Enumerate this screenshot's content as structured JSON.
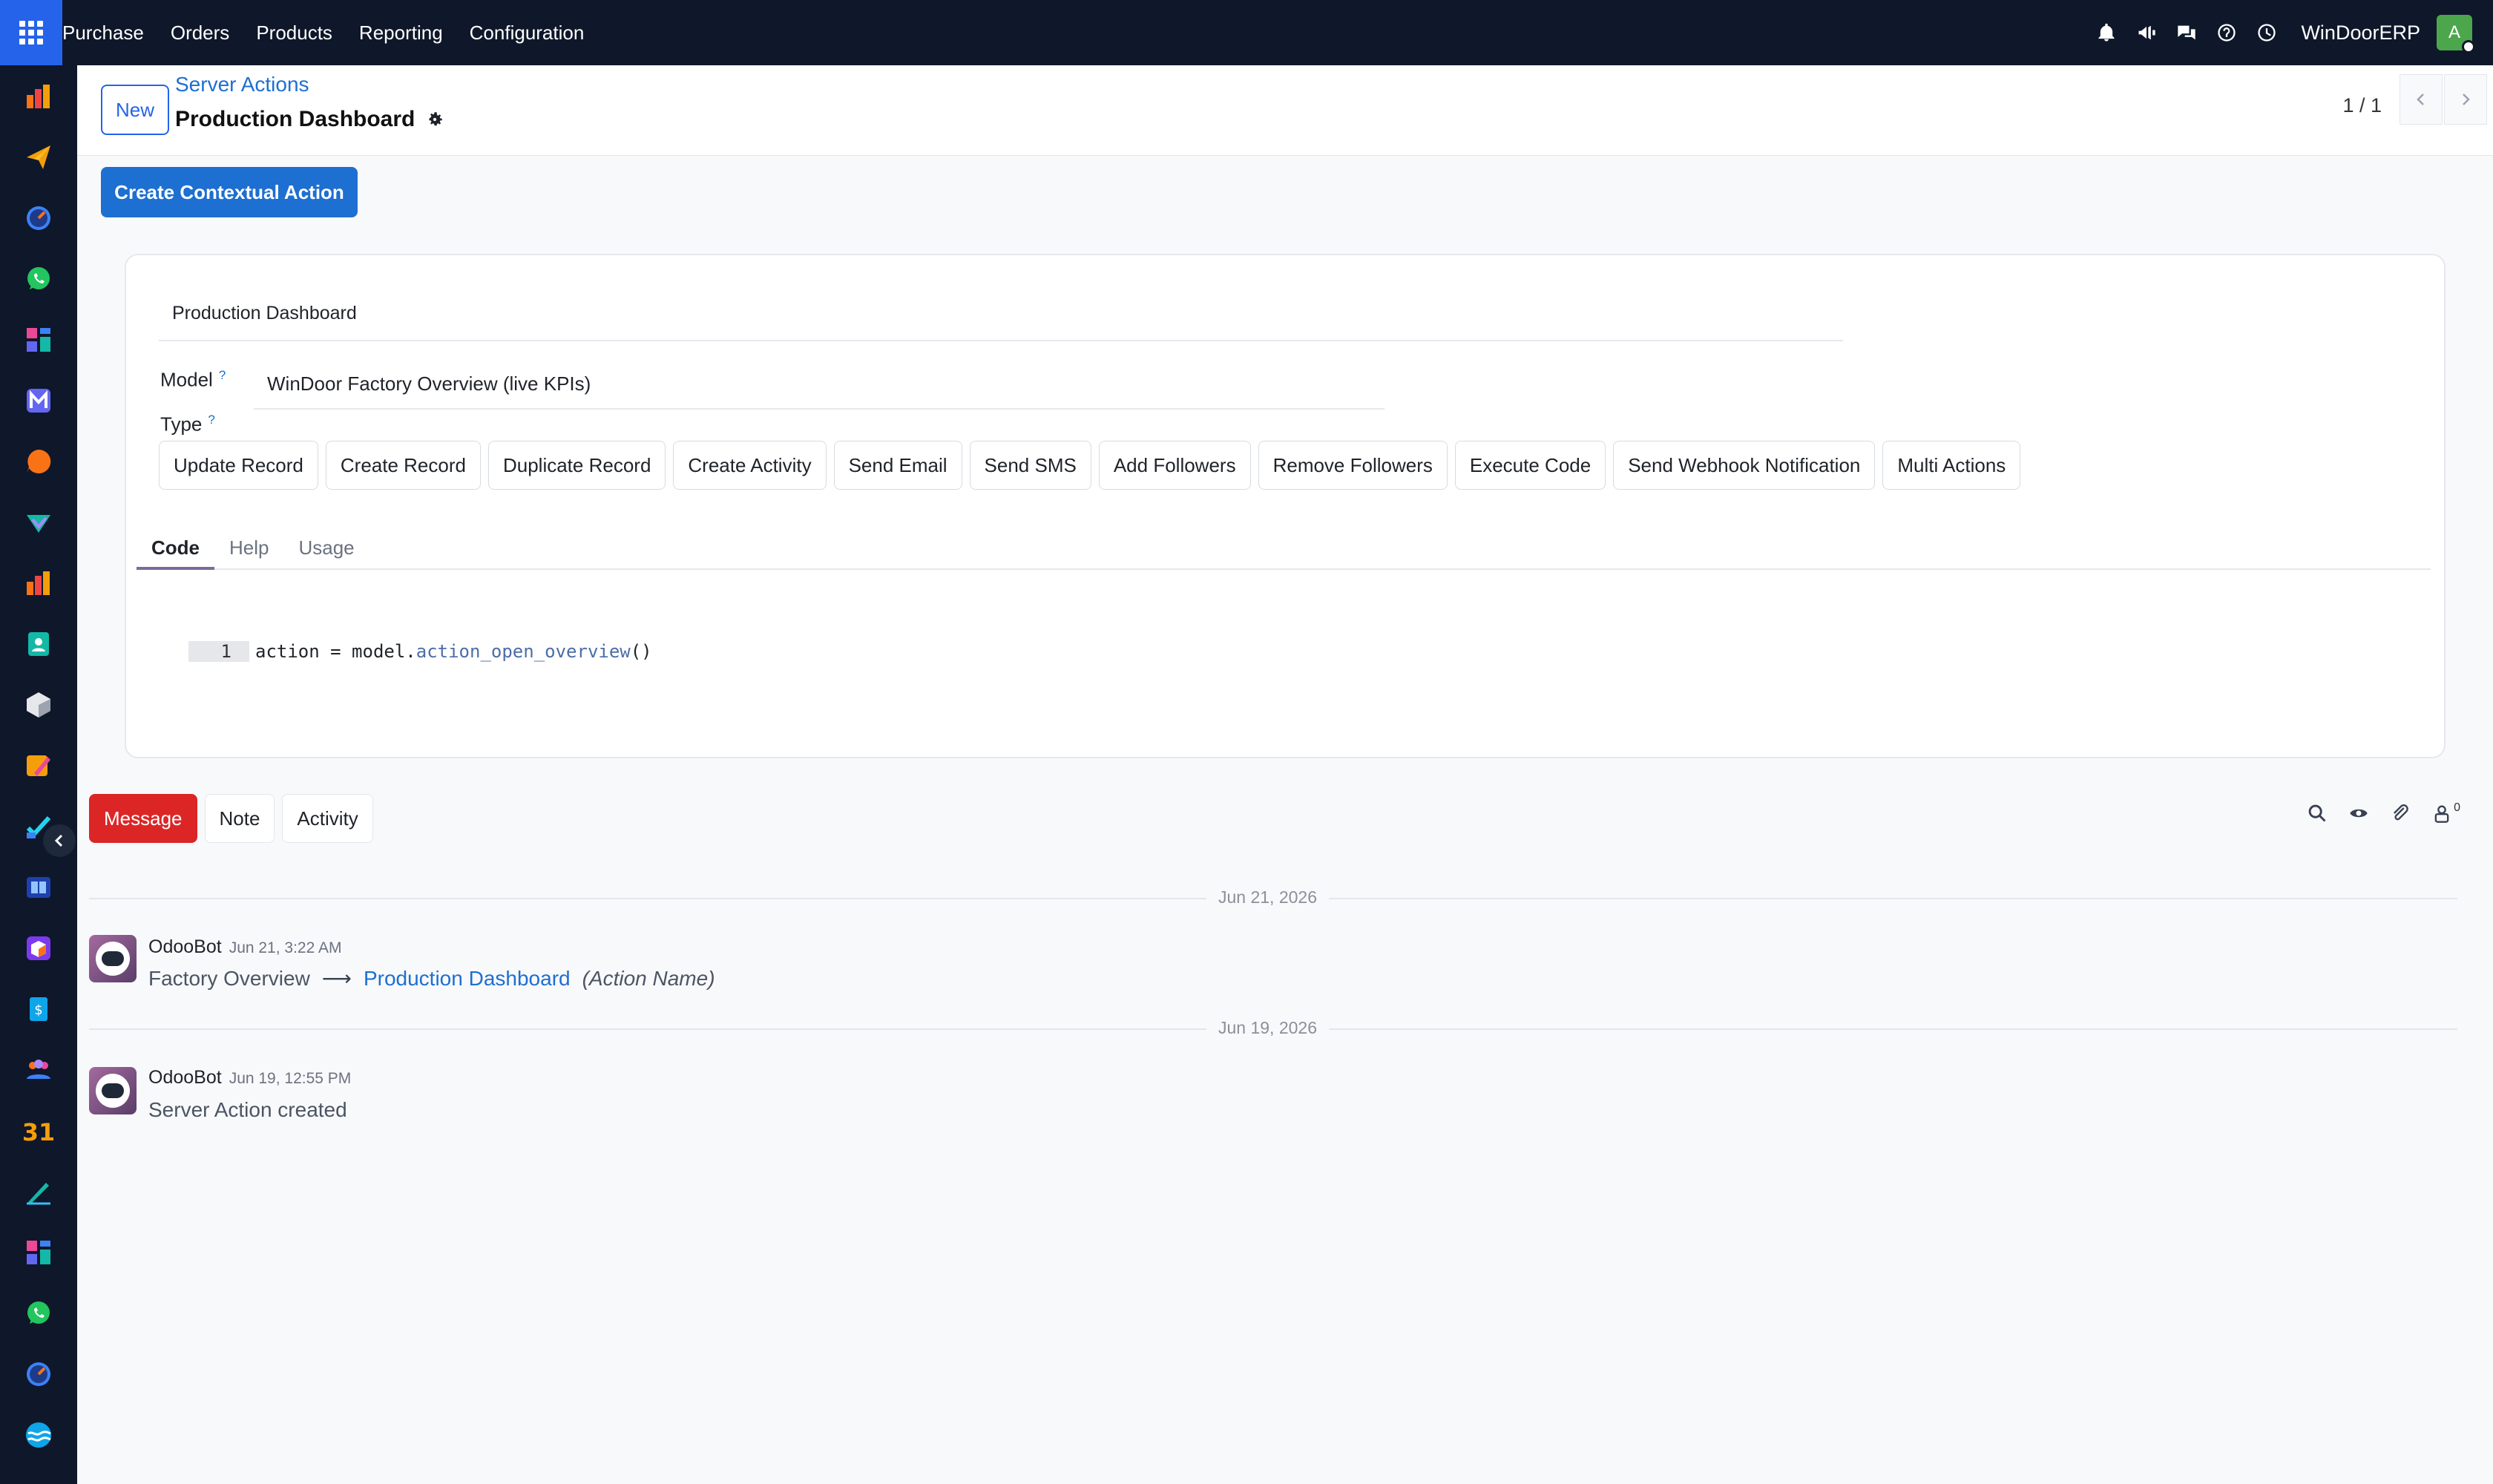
{
  "topbar": {
    "nav": [
      "Purchase",
      "Orders",
      "Products",
      "Reporting",
      "Configuration"
    ],
    "company": "WinDoorERP",
    "user_initial": "A",
    "icons": [
      "bell-icon",
      "megaphone-icon",
      "chat-icon",
      "help-icon",
      "clock-icon"
    ]
  },
  "sidebar": {
    "icons": [
      "dashboard-app-icon",
      "send-app-icon",
      "timer-app-icon",
      "whatsapp-app-icon",
      "grid-app-icon",
      "mail-app-icon",
      "chat-bubble-app-icon",
      "check-app-icon",
      "bar-chart-app-icon",
      "contact-app-icon",
      "cube-app-icon",
      "pencil-app-icon",
      "task-app-icon",
      "book-app-icon",
      "box-app-icon",
      "invoice-app-icon",
      "team-app-icon",
      "calendar-app-icon",
      "sign-app-icon",
      "grid2-app-icon",
      "whatsapp2-app-icon",
      "timer2-app-icon",
      "wave-app-icon"
    ],
    "calendar_number": "31"
  },
  "control": {
    "new_label": "New",
    "breadcrumb_parent": "Server Actions",
    "record_title": "Production Dashboard",
    "pager": "1 / 1"
  },
  "actions": {
    "create_contextual": "Create Contextual Action"
  },
  "form": {
    "name_value": "Production Dashboard",
    "model_label": "Model",
    "model_value": "WinDoor Factory Overview (live KPIs)",
    "type_label": "Type",
    "help_mark": "?",
    "types": [
      "Update Record",
      "Create Record",
      "Duplicate Record",
      "Create Activity",
      "Send Email",
      "Send SMS",
      "Add Followers",
      "Remove Followers",
      "Execute Code",
      "Send Webhook Notification",
      "Multi Actions"
    ],
    "tabs": [
      "Code",
      "Help",
      "Usage"
    ],
    "code_line_no": "1",
    "code_prefix": "action = model.",
    "code_fn": "action_open_overview",
    "code_suffix": "()"
  },
  "chatter": {
    "buttons": [
      "Message",
      "Note",
      "Activity"
    ],
    "followers_count": "0",
    "messages": [
      {
        "date": "Jun 21, 2026",
        "author": "OdooBot",
        "timestamp": "Jun 21, 3:22 AM",
        "old_value": "Factory Overview",
        "arrow": "⟶",
        "new_value": "Production Dashboard",
        "field": "(Action Name)"
      },
      {
        "date": "Jun 19, 2026",
        "author": "OdooBot",
        "timestamp": "Jun 19, 12:55 PM",
        "body": "Server Action created"
      }
    ]
  },
  "colors": {
    "topbar_bg": "#0f172a",
    "primary": "#1d6fd1",
    "message_btn": "#dc2626",
    "avatar": "#4ca64c"
  }
}
